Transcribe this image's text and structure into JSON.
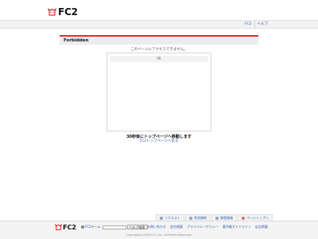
{
  "header": {
    "logo_text": "FC2",
    "nav_links": [
      "FC2",
      "ヘルプ"
    ]
  },
  "page": {
    "title": "Forbidden",
    "message": "このページにアクセスできません。",
    "ad_label": "PR",
    "redirect_notice": "30秒後にトップページへ移動します",
    "back_link": "FC2トップページへ戻る"
  },
  "footer": {
    "tabs": [
      {
        "label": "リクエスト",
        "icon": "lightbulb-icon"
      },
      {
        "label": "利用規約",
        "icon": "document-icon"
      },
      {
        "label": "障害情報",
        "icon": "warning-icon"
      },
      {
        "label": "ページトップへ",
        "icon": "heart-icon"
      }
    ],
    "logo_text": "FC2",
    "search_option": "FC2ホーム",
    "search_button": "ヘルプ検索",
    "links": [
      "お問い合わせ",
      "会社概要",
      "プライバシーポリシー",
      "著作権ガイドライン",
      "広告掲載"
    ],
    "copyright": "Copyright(c)1999 FC2, Inc. All Rights Reserved."
  },
  "colors": {
    "accent_red": "#d83030",
    "link_blue": "#2a5db0"
  }
}
